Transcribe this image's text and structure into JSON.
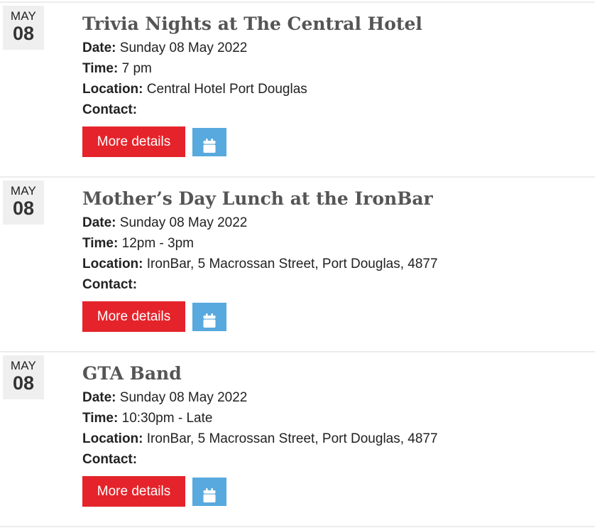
{
  "events": [
    {
      "month": "MAY",
      "day": "08",
      "title": "Trivia Nights at The Central Hotel",
      "date_label": "Date:",
      "date_value": "Sunday 08 May 2022",
      "time_label": "Time:",
      "time_value": "7 pm",
      "location_label": "Location:",
      "location_value": "Central Hotel Port Douglas",
      "contact_label": "Contact:",
      "contact_value": "",
      "more_label": "More details",
      "calendar_icon": "calendar-icon"
    },
    {
      "month": "MAY",
      "day": "08",
      "title": "Mother’s Day Lunch at the IronBar",
      "date_label": "Date:",
      "date_value": "Sunday 08 May 2022",
      "time_label": "Time:",
      "time_value": "12pm - 3pm",
      "location_label": "Location:",
      "location_value": "IronBar, 5 Macrossan Street, Port Douglas, 4877",
      "contact_label": "Contact:",
      "contact_value": "",
      "more_label": "More details",
      "calendar_icon": "calendar-icon"
    },
    {
      "month": "MAY",
      "day": "08",
      "title": "GTA Band",
      "date_label": "Date:",
      "date_value": "Sunday 08 May 2022",
      "time_label": "Time:",
      "time_value": "10:30pm - Late",
      "location_label": "Location:",
      "location_value": "IronBar, 5 Macrossan Street, Port Douglas, 4877",
      "contact_label": "Contact:",
      "contact_value": "",
      "more_label": "More details",
      "calendar_icon": "calendar-icon"
    }
  ],
  "colors": {
    "more_button": "#e5232a",
    "calendar_button": "#58a9dd",
    "title": "#555555",
    "date_badge_bg": "#efefef"
  }
}
